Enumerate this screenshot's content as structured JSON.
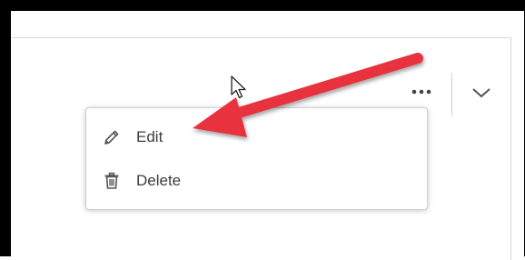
{
  "menu": {
    "items": [
      {
        "label": "Edit",
        "icon": "pencil-icon"
      },
      {
        "label": "Delete",
        "icon": "trash-icon"
      }
    ]
  },
  "toolbar": {
    "more_icon": "ellipsis-icon",
    "expand_icon": "chevron-down-icon"
  },
  "annotation": {
    "arrow_color": "#e8333c"
  },
  "colors": {
    "icon": "#555555",
    "text": "#3c3c3c",
    "border": "#cfcfcf"
  }
}
